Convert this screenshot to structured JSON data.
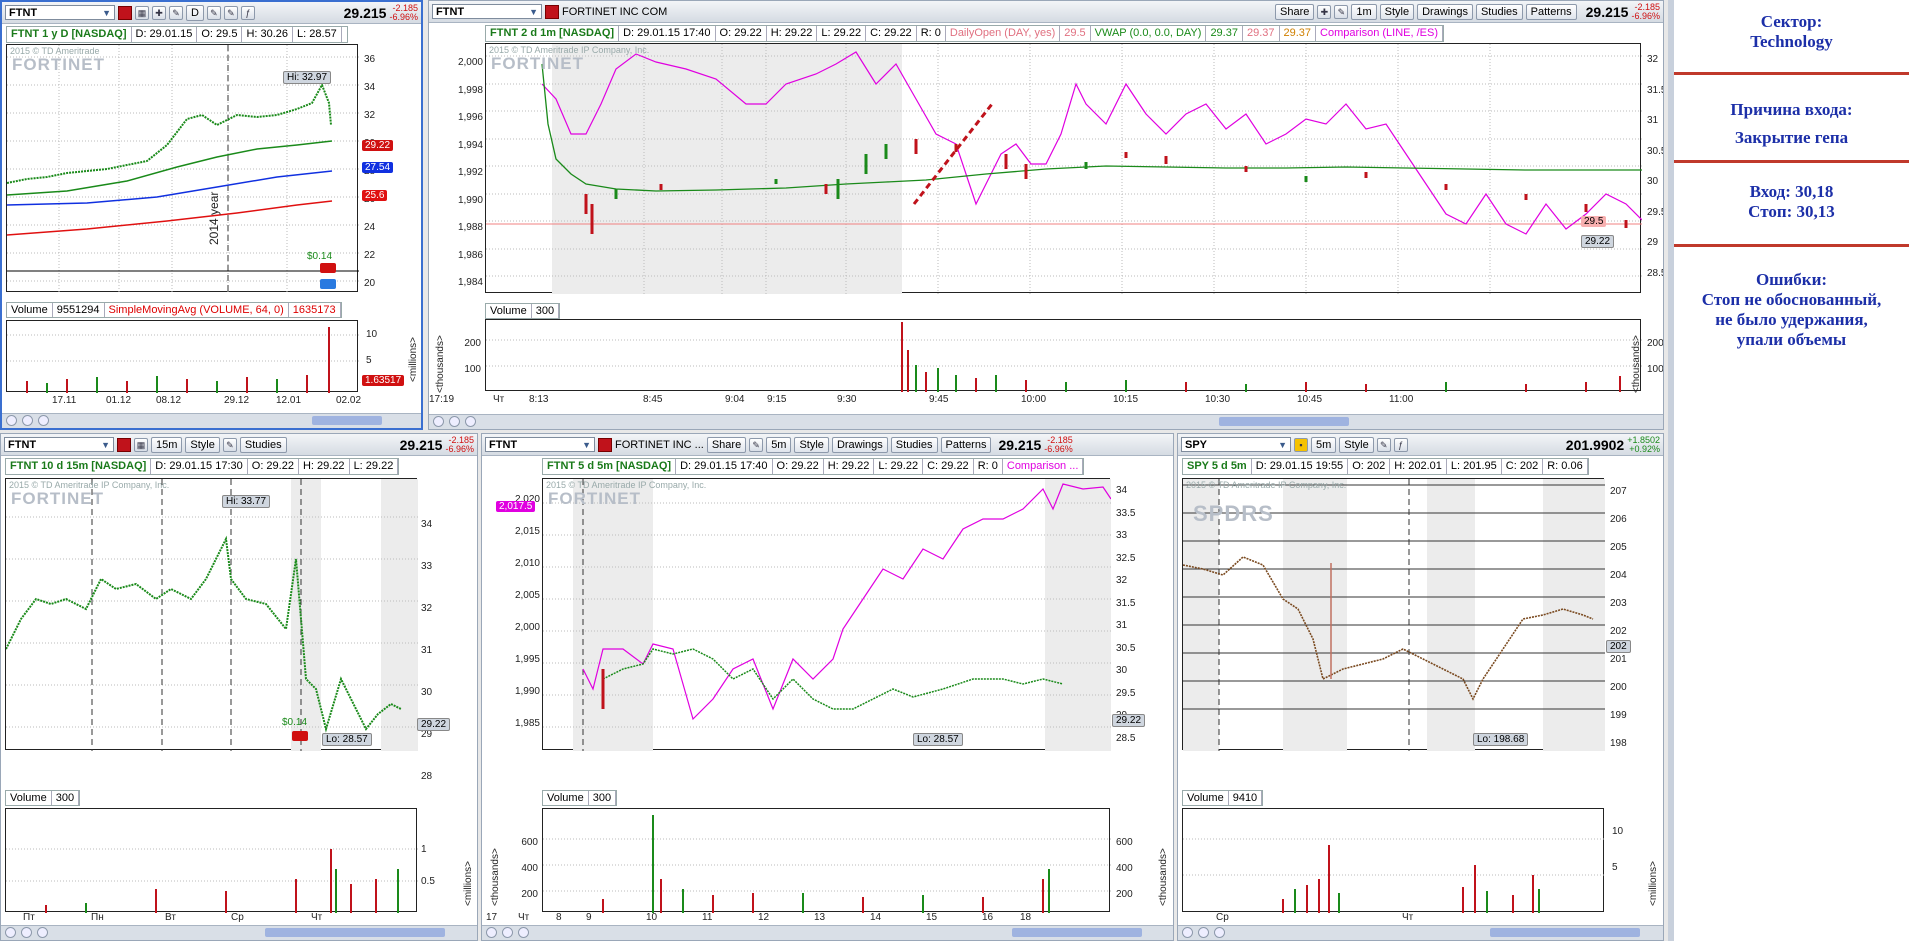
{
  "colors": {
    "up": "#1a8a1a",
    "down": "#c0121b",
    "accent": "#e000e0",
    "notes": "#1c2fa8"
  },
  "panel_tl": {
    "symbol": "FTNT",
    "period": "D",
    "price": "29.215",
    "chg1": "-2.185",
    "chg2": "-6.96%",
    "title": "FTNT 1 y D [NASDAQ]",
    "date": "D: 29.01.15",
    "open": "O: 29.5",
    "high": "H: 30.26",
    "low": "L: 28.57",
    "copyright": "2015 © TD Ameritrade",
    "logo": "FORTINET",
    "hi_label": "Hi: 32.97",
    "year_label": "2014 year",
    "div": "$0.14",
    "yticks": [
      "36",
      "34",
      "32",
      "30",
      "28",
      "26",
      "24",
      "22",
      "20"
    ],
    "tags": [
      "29.22",
      "27.54",
      "25.6"
    ],
    "vol_label": "Volume",
    "vol_value": "9551294",
    "sma": "SimpleMovingAvg (VOLUME, 64, 0)",
    "sma_value": "1635173",
    "vol_ticks": [
      "10",
      "5",
      "1.63517"
    ],
    "vol_unit": "<millions>",
    "xticks": [
      "17.11",
      "01.12",
      "08.12",
      "29.12",
      "12.01",
      "02.02"
    ]
  },
  "panel_main": {
    "symbol": "FTNT",
    "company": "FORTINET INC COM",
    "share": "Share",
    "period": "1m",
    "style": "Style",
    "drawings": "Drawings",
    "studies": "Studies",
    "patterns": "Patterns",
    "price": "29.215",
    "chg1": "-2.185",
    "chg2": "-6.96%",
    "title": "FTNT 2 d 1m [NASDAQ]",
    "date": "D: 29.01.15 17:40",
    "open": "O: 29.22",
    "high": "H: 29.22",
    "low": "L: 29.22",
    "close": "C: 29.22",
    "r": "R: 0",
    "dailyopen": "DailyOpen (DAY, yes)",
    "dailyopen_v": "29.5",
    "vwap": "VWAP (0.0, 0.0, DAY)",
    "vwap_v1": "29.37",
    "vwap_v2": "29.37",
    "vwap_v3": "29.37",
    "comparison": "Comparison (LINE, /ES)",
    "copyright": "2015 © TD Ameritrade IP Company, Inc.",
    "logo": "FORTINET",
    "left_ticks": [
      "2,000",
      "1,998",
      "1,996",
      "1,994",
      "1,992",
      "1,990",
      "1,988",
      "1,986",
      "1,984"
    ],
    "right_ticks": [
      "32",
      "31.5",
      "31",
      "30.5",
      "30",
      "29.5",
      "29",
      "28.5"
    ],
    "tag1": "29.5",
    "tag2": "29.22",
    "vol_label": "Volume",
    "vol_value": "300",
    "vol_ticks": [
      "200",
      "100"
    ],
    "vol_unit": "<thousands>",
    "xticks": [
      "17:19",
      "Чт",
      "8:13",
      "8:45",
      "9:04",
      "9:15",
      "9:30",
      "9:45",
      "10:00",
      "10:15",
      "10:30",
      "10:45",
      "11:00"
    ]
  },
  "panel_bl": {
    "symbol": "FTNT",
    "period": "15m",
    "style": "Style",
    "studies": "Studies",
    "price": "29.215",
    "chg1": "-2.185",
    "chg2": "-6.96%",
    "title": "FTNT 10 d 15m [NASDAQ]",
    "date": "D: 29.01.15 17:30",
    "open": "O: 29.22",
    "high": "H: 29.22",
    "low": "L: 29.22",
    "copyright": "2015 © TD Ameritrade IP Company, Inc.",
    "logo": "FORTINET",
    "hi": "Hi: 33.77",
    "lo": "Lo: 28.57",
    "div": "$0.14",
    "yticks": [
      "34",
      "33",
      "32",
      "31",
      "30",
      "29",
      "28"
    ],
    "tag": "29.22",
    "vol_label": "Volume",
    "vol_value": "300",
    "vol_ticks": [
      "1",
      "0.5"
    ],
    "vol_unit": "<millions>",
    "xticks": [
      "Пт",
      "Пн",
      "Вт",
      "Ср",
      "Чт"
    ]
  },
  "panel_bm": {
    "symbol": "FTNT",
    "company": "FORTINET INC ...",
    "share": "Share",
    "period": "5m",
    "style": "Style",
    "drawings": "Drawings",
    "studies": "Studies",
    "patterns": "Patterns",
    "price": "29.215",
    "chg1": "-2.185",
    "chg2": "-6.96%",
    "title": "FTNT 5 d 5m [NASDAQ]",
    "date": "D: 29.01.15 17:40",
    "open": "O: 29.22",
    "high": "H: 29.22",
    "low": "L: 29.22",
    "close": "C: 29.22",
    "r": "R: 0",
    "comparison": "Comparison ...",
    "copyright": "2015 © TD Ameritrade IP Company, Inc.",
    "logo": "FORTINET",
    "left_ticks": [
      "2,020",
      "2,015",
      "2,010",
      "2,005",
      "2,000",
      "1,995",
      "1,990",
      "1,985"
    ],
    "left_tag": "2,017.5",
    "right_ticks": [
      "34",
      "33.5",
      "33",
      "32.5",
      "32",
      "31.5",
      "31",
      "30.5",
      "30",
      "29.5",
      "29",
      "28.5"
    ],
    "tag": "29.22",
    "lo": "Lo: 28.57",
    "vol_label": "Volume",
    "vol_value": "300",
    "vol_ticks": [
      "600",
      "400",
      "200"
    ],
    "vol_unit": "<thousands>",
    "xticks": [
      "17",
      "Чт",
      "8",
      "9",
      "10",
      "11",
      "12",
      "13",
      "14",
      "15",
      "16",
      "18"
    ]
  },
  "panel_br": {
    "symbol": "SPY",
    "period": "5m",
    "style": "Style",
    "price": "201.9902",
    "chg1": "+1.8502",
    "chg2": "+0.92%",
    "title": "SPY 5 d 5m",
    "date": "D: 29.01.15 19:55",
    "open": "O: 202",
    "high": "H: 202.01",
    "low": "L: 201.95",
    "close": "C: 202",
    "r": "R: 0.06",
    "copyright": "2015 © TD Ameritrade IP Company, Inc.",
    "logo": "SPDRS",
    "yticks": [
      "207",
      "206",
      "205",
      "204",
      "203",
      "202",
      "201",
      "200",
      "199",
      "198"
    ],
    "tag": "202",
    "lo": "Lo: 198.68",
    "vol_label": "Volume",
    "vol_value": "9410",
    "vol_ticks": [
      "10",
      "5"
    ],
    "vol_unit": "<millions>",
    "xticks": [
      "Ср",
      "Чт"
    ]
  },
  "notes": {
    "sector_title": "Сектор:",
    "sector": "Technology",
    "reason_title": "Причина входа:",
    "reason": "Закрытие гепа",
    "entry": "Вход: 30,18",
    "stop": "Стоп: 30,13",
    "errors_title": "Ошибки:",
    "errors_1": "Стоп не обоснованный,",
    "errors_2": "не было удержания,",
    "errors_3": "упали объемы"
  }
}
